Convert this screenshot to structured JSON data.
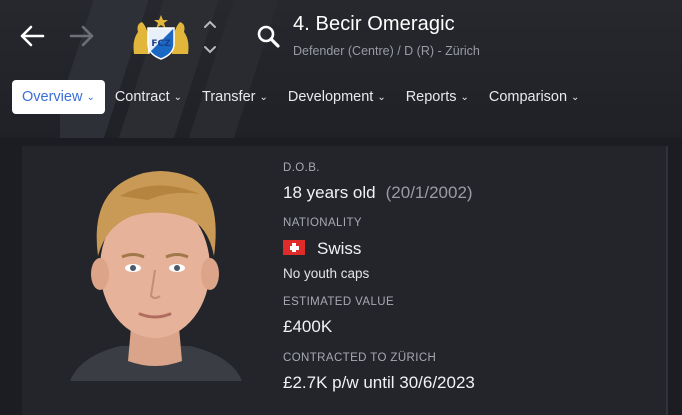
{
  "header": {
    "player_name": "4. Becir Omeragic",
    "player_sub": "Defender (Centre) / D (R) - Zürich",
    "club_crest_text": "FCZ"
  },
  "nav": {
    "back_icon": "arrow-left-icon",
    "forward_icon": "arrow-right-icon",
    "search_icon": "search-icon"
  },
  "tabs": [
    {
      "label": "Overview",
      "active": true
    },
    {
      "label": "Contract",
      "active": false
    },
    {
      "label": "Transfer",
      "active": false
    },
    {
      "label": "Development",
      "active": false
    },
    {
      "label": "Reports",
      "active": false
    },
    {
      "label": "Comparison",
      "active": false
    }
  ],
  "profile": {
    "dob_label": "D.O.B.",
    "age": "18 years old",
    "dob": "(20/1/2002)",
    "nationality_label": "NATIONALITY",
    "nationality": "Swiss",
    "youth_caps": "No youth caps",
    "value_label": "ESTIMATED VALUE",
    "value": "£400K",
    "contract_label": "CONTRACTED TO ZÜRICH",
    "contract": "£2.7K p/w until 30/6/2023"
  },
  "colors": {
    "accent": "#3a6fd8",
    "background": "#1b1d22",
    "card": "#23252b",
    "flag_red": "#e02b2b"
  }
}
